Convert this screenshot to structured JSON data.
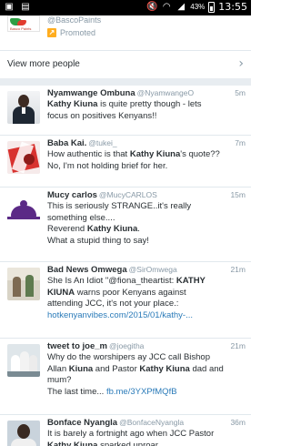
{
  "status_bar": {
    "battery_percent": "43%",
    "time": "13:55"
  },
  "promoted_account": {
    "handle": "@BascoPaints",
    "logo_text": "Basco Paints",
    "promoted_label": "Promoted"
  },
  "view_more": {
    "label": "View more people"
  },
  "tweets": [
    {
      "name": "Nyamwange Ombuna",
      "screen_name": "@NyamwangeO",
      "time": "5m",
      "lines": [
        [
          {
            "t": "Kathy Kiuna",
            "b": true
          },
          {
            "t": " is quite pretty though - lets"
          }
        ],
        [
          {
            "t": "focus on positives Kenyans!!"
          }
        ]
      ]
    },
    {
      "name": "Baba Kai.",
      "screen_name": "@tukei_",
      "time": "7m",
      "lines": [
        [
          {
            "t": "How authentic is that "
          },
          {
            "t": "Kathy Kiuna",
            "b": true
          },
          {
            "t": "'s quote??"
          }
        ],
        [
          {
            "t": "No, I'm not holding brief for her."
          }
        ]
      ]
    },
    {
      "name": "Mucy carlos",
      "screen_name": "@MucyCARLOS",
      "time": "15m",
      "lines": [
        [
          {
            "t": "This is seriously STRANGE..it's really"
          }
        ],
        [
          {
            "t": "something else...."
          }
        ],
        [
          {
            "t": "Reverend "
          },
          {
            "t": "Kathy Kiuna",
            "b": true
          },
          {
            "t": "."
          }
        ],
        [
          {
            "t": "What a stupid thing to say!"
          }
        ]
      ]
    },
    {
      "name": "Bad News Omwega",
      "screen_name": "@SirOmwega",
      "time": "21m",
      "lines": [
        [
          {
            "t": "She Is An Idiot \"@fiona_theartist: "
          },
          {
            "t": "KATHY",
            "b": true
          }
        ],
        [
          {
            "t": "KIUNA",
            "b": true
          },
          {
            "t": " warns poor Kenyans against"
          }
        ],
        [
          {
            "t": "attending JCC, it's not your place.:"
          }
        ],
        [
          {
            "t": "hotkenyanvibes.com/2015/01/kathy-...",
            "link": true
          }
        ]
      ]
    },
    {
      "name": "tweet to joe_m",
      "screen_name": "@joegitha",
      "time": "21m",
      "lines": [
        [
          {
            "t": "Why do the worshipers ay JCC call Bishop"
          }
        ],
        [
          {
            "t": "Allan "
          },
          {
            "t": "Kiuna",
            "b": true
          },
          {
            "t": " and Pastor "
          },
          {
            "t": "Kathy Kiuna",
            "b": true
          },
          {
            "t": " dad and"
          }
        ],
        [
          {
            "t": "mum?"
          }
        ],
        [
          {
            "t": "The last time... "
          },
          {
            "t": "fb.me/3YXPfMQfB",
            "link": true
          }
        ]
      ]
    },
    {
      "name": "Bonface Nyangla",
      "screen_name": "@BonfaceNyangla",
      "time": "36m",
      "lines": [
        [
          {
            "t": "It is barely a fortnight ago when JCC Pastor"
          }
        ],
        [
          {
            "t": "Kathy Kiuna",
            "b": true
          },
          {
            "t": " sparked uproar"
          }
        ]
      ]
    }
  ]
}
